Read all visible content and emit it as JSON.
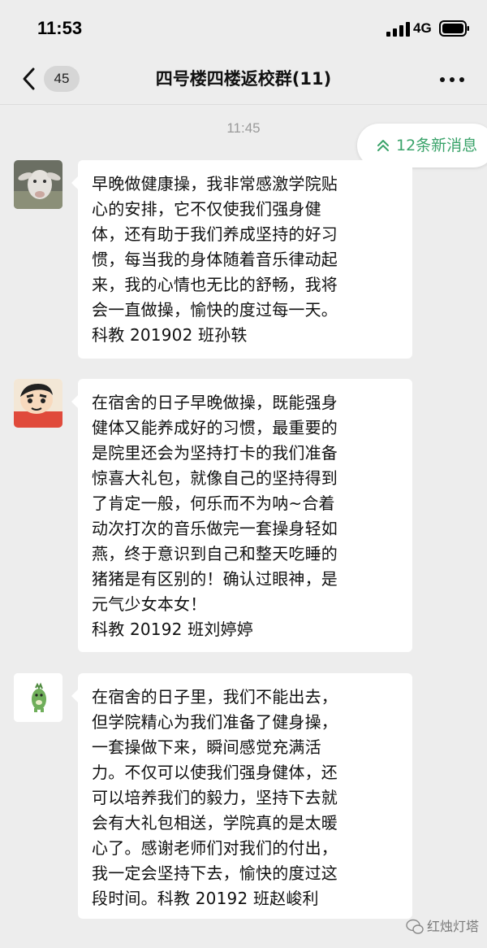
{
  "status_bar": {
    "time": "11:53",
    "network": "4G"
  },
  "nav": {
    "unread_count": "45",
    "title": "四号楼四楼返校群(11)"
  },
  "chat": {
    "timestamp": "11:45",
    "new_messages_label": "12条新消息",
    "messages": [
      {
        "text": "早晚做健康操，我非常感激学院贴\n心的安排，它不仅使我们强身健\n体，还有助于我们养成坚持的好习\n惯，每当我的身体随着音乐律动起\n来，我的心情也无比的舒畅，我将\n会一直做操，愉快的度过每一天。\n           科教 201902 班孙轶"
      },
      {
        "text": "在宿舍的日子早晚做操，既能强身\n健体又能养成好的习惯，最重要的\n是院里还会为坚持打卡的我们准备\n惊喜大礼包，就像自己的坚持得到\n了肯定一般，何乐而不为呐~合着\n动次打次的音乐做完一套操身轻如\n燕，终于意识到自己和整天吃睡的\n猪猪是有区别的！确认过眼神，是\n元气少女本女！\n           科教 20192 班刘婷婷"
      },
      {
        "text": "在宿舍的日子里，我们不能出去，\n但学院精心为我们准备了健身操，\n一套操做下来，瞬间感觉充满活\n力。不仅可以使我们强身健体，还\n可以培养我们的毅力，坚持下去就\n会有大礼包相送，学院真的是太暖\n心了。感谢老师们对我们的付出，\n我一定会坚持下去，愉快的度过这\n段时间。科教 20192 班赵峻利"
      }
    ]
  },
  "watermark": {
    "text": "红烛灯塔"
  },
  "colors": {
    "background": "#ededed",
    "bubble": "#ffffff",
    "accent_green": "#3aa36a"
  }
}
